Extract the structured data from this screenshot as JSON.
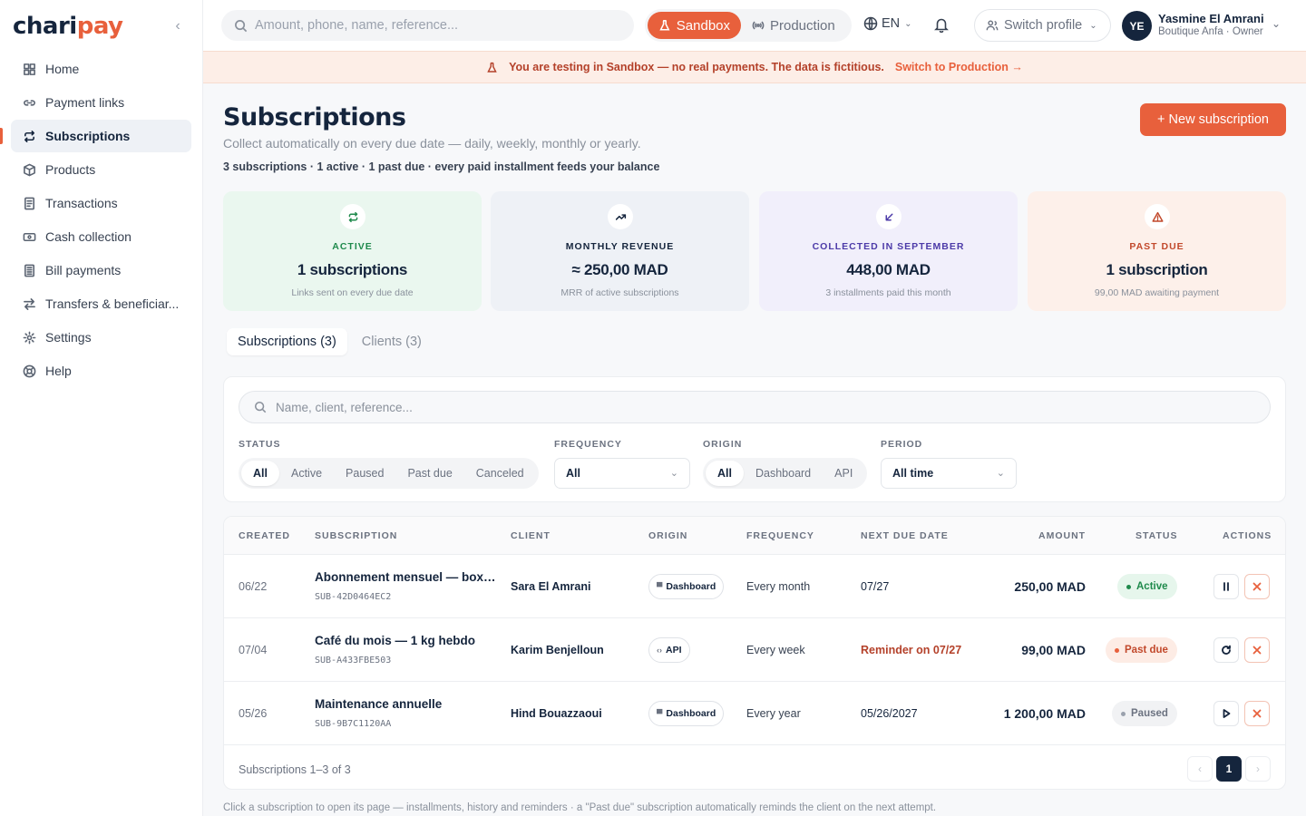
{
  "app": {
    "logo_part1": "chari",
    "logo_part2": "pay"
  },
  "sidebar": {
    "items": [
      {
        "label": "Home",
        "icon": "grid-icon"
      },
      {
        "label": "Payment links",
        "icon": "link-icon"
      },
      {
        "label": "Subscriptions",
        "icon": "repeat-icon",
        "active": true
      },
      {
        "label": "Products",
        "icon": "box-icon"
      },
      {
        "label": "Transactions",
        "icon": "receipt-icon"
      },
      {
        "label": "Cash collection",
        "icon": "cash-icon"
      },
      {
        "label": "Bill payments",
        "icon": "bill-icon"
      },
      {
        "label": "Transfers & beneficiar...",
        "icon": "transfer-icon"
      },
      {
        "label": "Settings",
        "icon": "gear-icon"
      },
      {
        "label": "Help",
        "icon": "help-icon"
      }
    ]
  },
  "topbar": {
    "search_placeholder": "Amount, phone, name, reference...",
    "env_sandbox": "Sandbox",
    "env_production": "Production",
    "language": "EN",
    "switch_profile": "Switch profile",
    "user_initials": "YE",
    "user_name": "Yasmine El Amrani",
    "user_role": "Boutique Anfa · Owner"
  },
  "banner": {
    "text": "You are testing in Sandbox — no real payments. The data is fictitious.",
    "link": "Switch to Production →"
  },
  "page": {
    "title": "Subscriptions",
    "subtitle": "Collect automatically on every due date — daily, weekly, monthly or yearly.",
    "summary": "3 subscriptions · 1 active · 1 past due · every paid installment feeds your balance",
    "new_button": "+ New subscription"
  },
  "cards": [
    {
      "label": "ACTIVE",
      "value": "1 subscriptions",
      "note": "Links sent on every due date",
      "bg": "#eaf7ef",
      "accent": "#1f8a4c"
    },
    {
      "label": "MONTHLY REVENUE",
      "value": "≈ 250,00 MAD",
      "note": "MRR of active subscriptions",
      "bg": "#eef1f6",
      "accent": "#15253d"
    },
    {
      "label": "COLLECTED IN SEPTEMBER",
      "value": "448,00 MAD",
      "note": "3 installments paid this month",
      "bg": "#f1effb",
      "accent": "#4c3aa8"
    },
    {
      "label": "PAST DUE",
      "value": "1 subscription",
      "note": "99,00 MAD awaiting payment",
      "bg": "#fdf0ea",
      "accent": "#c2492c"
    }
  ],
  "tabs": {
    "subscriptions": "Subscriptions (3)",
    "clients": "Clients (3)"
  },
  "filters": {
    "search_placeholder": "Name, client, reference...",
    "status_label": "STATUS",
    "status_options": [
      "All",
      "Active",
      "Paused",
      "Past due",
      "Canceled"
    ],
    "frequency_label": "FREQUENCY",
    "frequency_value": "All",
    "origin_label": "ORIGIN",
    "origin_options": [
      "All",
      "Dashboard",
      "API"
    ],
    "period_label": "PERIOD",
    "period_value": "All time"
  },
  "table": {
    "headers": [
      "CREATED",
      "SUBSCRIPTION",
      "CLIENT",
      "ORIGIN",
      "FREQUENCY",
      "NEXT DUE DATE",
      "AMOUNT",
      "STATUS",
      "ACTIONS"
    ],
    "rows": [
      {
        "created": "06/22",
        "name": "Abonnement mensuel — box ...",
        "ref": "SUB-42D0464EC2",
        "client": "Sara El Amrani",
        "origin": "Dashboard",
        "frequency": "Every month",
        "due": "07/27",
        "amount": "250,00 MAD",
        "status": "Active"
      },
      {
        "created": "07/04",
        "name": "Café du mois — 1 kg hebdo",
        "ref": "SUB-A433FBE503",
        "client": "Karim Benjelloun",
        "origin": "API",
        "frequency": "Every week",
        "due": "Reminder on 07/27",
        "amount": "99,00 MAD",
        "status": "Past due"
      },
      {
        "created": "05/26",
        "name": "Maintenance annuelle",
        "ref": "SUB-9B7C1120AA",
        "client": "Hind Bouazzaoui",
        "origin": "Dashboard",
        "frequency": "Every year",
        "due": "05/26/2027",
        "amount": "1 200,00 MAD",
        "status": "Paused"
      }
    ],
    "count_text": "Subscriptions 1–3 of 3",
    "current_page": "1"
  },
  "footnote": "Click a subscription to open its page — installments, history and reminders · a \"Past due\" subscription automatically reminds the client on the next attempt.",
  "colors": {
    "brand": "#e8603c",
    "navy": "#15253d"
  }
}
